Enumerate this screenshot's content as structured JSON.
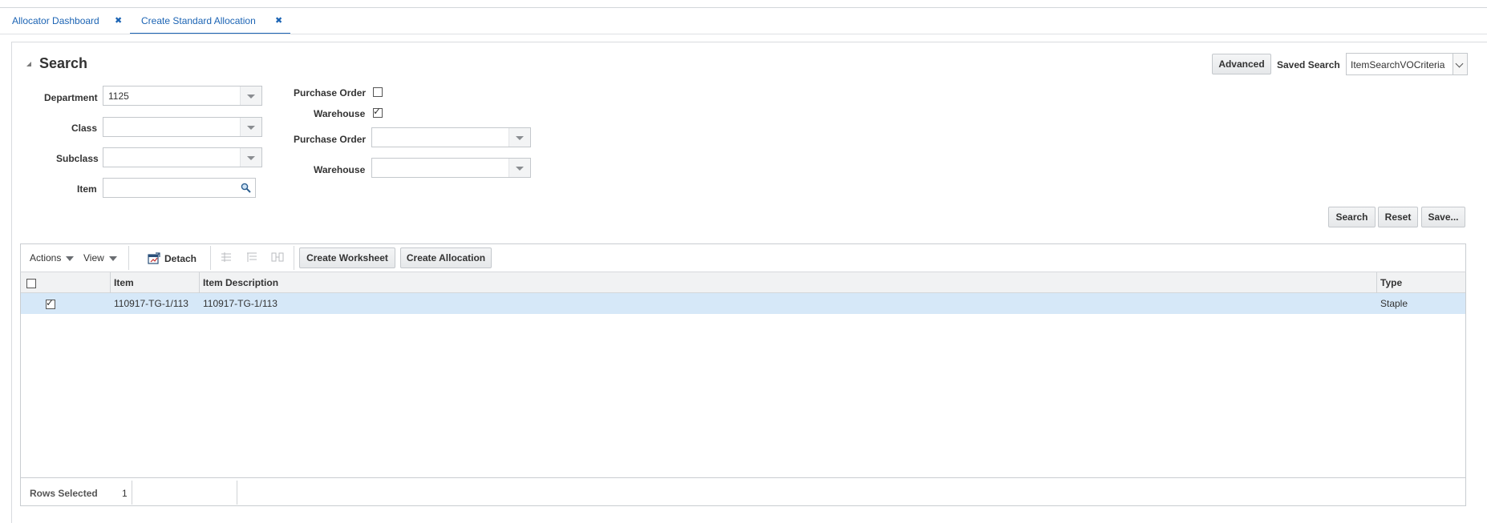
{
  "tabs": [
    {
      "label": "Allocator Dashboard",
      "close": "✖"
    },
    {
      "label": "Create Standard Allocation",
      "close": "✖"
    }
  ],
  "search": {
    "title": "Search",
    "advanced_label": "Advanced",
    "saved_search_label": "Saved Search",
    "saved_search_value": "ItemSearchVOCriteria",
    "fields": {
      "department_label": "Department",
      "department_value": "1125",
      "class_label": "Class",
      "class_value": "",
      "subclass_label": "Subclass",
      "subclass_value": "",
      "item_label": "Item",
      "item_value": "",
      "po_check_label": "Purchase Order",
      "po_checked": false,
      "warehouse_check_label": "Warehouse",
      "warehouse_checked": true,
      "po_select_label": "Purchase Order",
      "po_select_value": "",
      "warehouse_select_label": "Warehouse",
      "warehouse_select_value": ""
    },
    "buttons": {
      "search": "Search",
      "reset": "Reset",
      "save": "Save..."
    }
  },
  "toolbar": {
    "actions": "Actions",
    "view": "View",
    "detach": "Detach",
    "create_worksheet": "Create Worksheet",
    "create_allocation": "Create Allocation"
  },
  "table": {
    "columns": [
      "",
      "Item",
      "Item Description",
      "Type"
    ],
    "rows": [
      {
        "selected": true,
        "item": "110917-TG-1/113",
        "description": "110917-TG-1/113",
        "type": "Staple"
      }
    ]
  },
  "footer": {
    "rows_selected_label": "Rows Selected",
    "rows_selected_value": "1"
  },
  "colors": {
    "accent": "#1c64b4",
    "selected_row": "#d6e8f8"
  }
}
